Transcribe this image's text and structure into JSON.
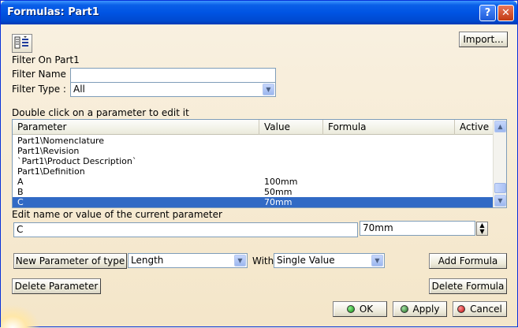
{
  "window": {
    "title": "Formulas: Part1",
    "help_label": "?",
    "close_label": "✕"
  },
  "toolbar": {
    "import_label": "Import...",
    "edit_icon": "formula-edit-icon"
  },
  "filter": {
    "heading": "Filter On Part1",
    "name_label": "Filter Name :",
    "name_value": "",
    "type_label": "Filter Type :",
    "type_value": "All"
  },
  "list": {
    "instruction": "Double click on a parameter to edit it",
    "columns": [
      "Parameter",
      "Value",
      "Formula",
      "Active"
    ],
    "rows": [
      {
        "name": "Part1\\Nomenclature",
        "value": ""
      },
      {
        "name": "Part1\\Revision",
        "value": ""
      },
      {
        "name": "`Part1\\Product Description`",
        "value": ""
      },
      {
        "name": "Part1\\Definition",
        "value": ""
      },
      {
        "name": "A",
        "value": "100mm"
      },
      {
        "name": "B",
        "value": "50mm"
      },
      {
        "name": "C",
        "value": "70mm"
      }
    ]
  },
  "edit": {
    "label": "Edit name or value of the current parameter",
    "name_value": "C",
    "value_value": "70mm"
  },
  "new_param": {
    "button_label": "New Parameter of type",
    "type_value": "Length",
    "with_label": "With",
    "with_value": "Single Value",
    "add_formula_label": "Add Formula"
  },
  "actions": {
    "delete_parameter_label": "Delete Parameter",
    "delete_formula_label": "Delete Formula",
    "ok_label": "OK",
    "apply_label": "Apply",
    "cancel_label": "Cancel"
  },
  "colors": {
    "selection": "#316ac5",
    "titlebar": "#0054e3"
  }
}
